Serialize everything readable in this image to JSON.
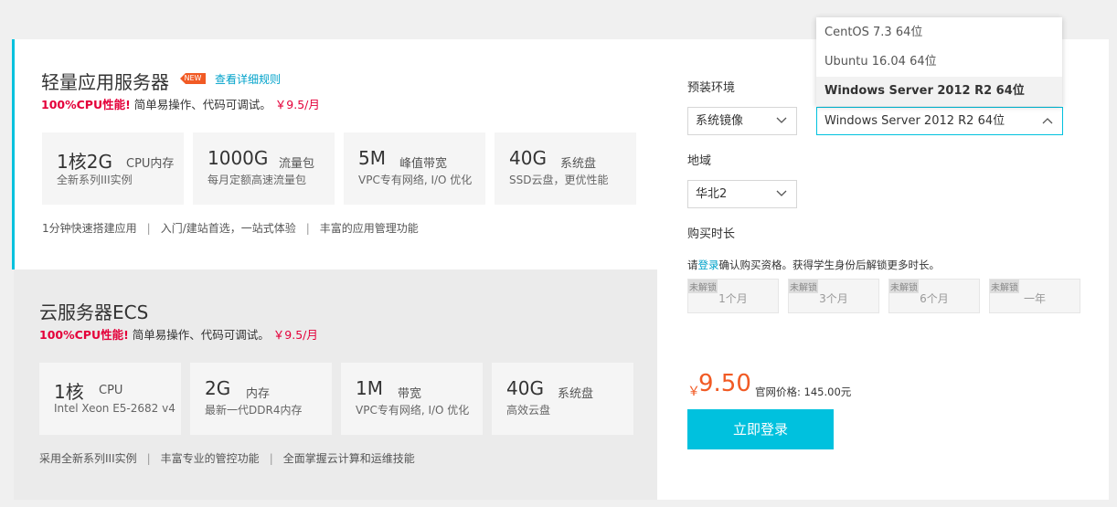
{
  "product1": {
    "title": "轻量应用服务器",
    "badge": "NEW",
    "rule_link": "查看详细规则",
    "perf_red": "100%CPU性能!",
    "perf_text": "简单易操作、代码可调试。",
    "perf_price": "￥9.5/月",
    "specs": [
      {
        "big": "1核2G",
        "small": "CPU内存",
        "desc": "全新系列III实例"
      },
      {
        "big": "1000G",
        "small": "流量包",
        "desc": "每月定额高速流量包"
      },
      {
        "big": "5M",
        "small": "峰值带宽",
        "desc": "VPC专有网络, I/O 优化"
      },
      {
        "big": "40G",
        "small": "系统盘",
        "desc": "SSD云盘，更优性能"
      }
    ],
    "features": [
      "1分钟快速搭建应用",
      "入门/建站首选，一站式体验",
      "丰富的应用管理功能"
    ]
  },
  "product2": {
    "title": "云服务器ECS",
    "perf_red": "100%CPU性能!",
    "perf_text": "简单易操作、代码可调试。",
    "perf_price": "￥9.5/月",
    "specs": [
      {
        "big": "1核",
        "small": "CPU",
        "desc": "Intel Xeon E5-2682 v4"
      },
      {
        "big": "2G",
        "small": "内存",
        "desc": "最新一代DDR4内存"
      },
      {
        "big": "1M",
        "small": "带宽",
        "desc": "VPC专有网络, I/O 优化"
      },
      {
        "big": "40G",
        "small": "系统盘",
        "desc": "高效云盘"
      }
    ],
    "features": [
      "采用全新系列III实例",
      "丰富专业的管控功能",
      "全面掌握云计算和运维技能"
    ]
  },
  "config": {
    "env_label": "预装环境",
    "image_select": "系统镜像",
    "os_select": "Windows Server 2012 R2 64位",
    "os_options": [
      "CentOS 7.3 64位",
      "Ubuntu 16.04 64位",
      "Windows Server 2012 R2 64位"
    ],
    "region_label": "地域",
    "region_select": "华北2",
    "duration_label": "购买时长",
    "notice_pre": "请",
    "notice_link": "登录",
    "notice_post": "确认购买资格。获得学生身份后解锁更多时长。",
    "lock_label": "未解锁",
    "durations": [
      "1个月",
      "3个月",
      "6个月",
      "一年"
    ],
    "currency": "￥",
    "price": "9.50",
    "official_price": "官网价格: 145.00元",
    "login_button": "立即登录"
  },
  "colors": {
    "accent": "#00c1de",
    "price": "#f15a24",
    "red": "#e4003a"
  }
}
